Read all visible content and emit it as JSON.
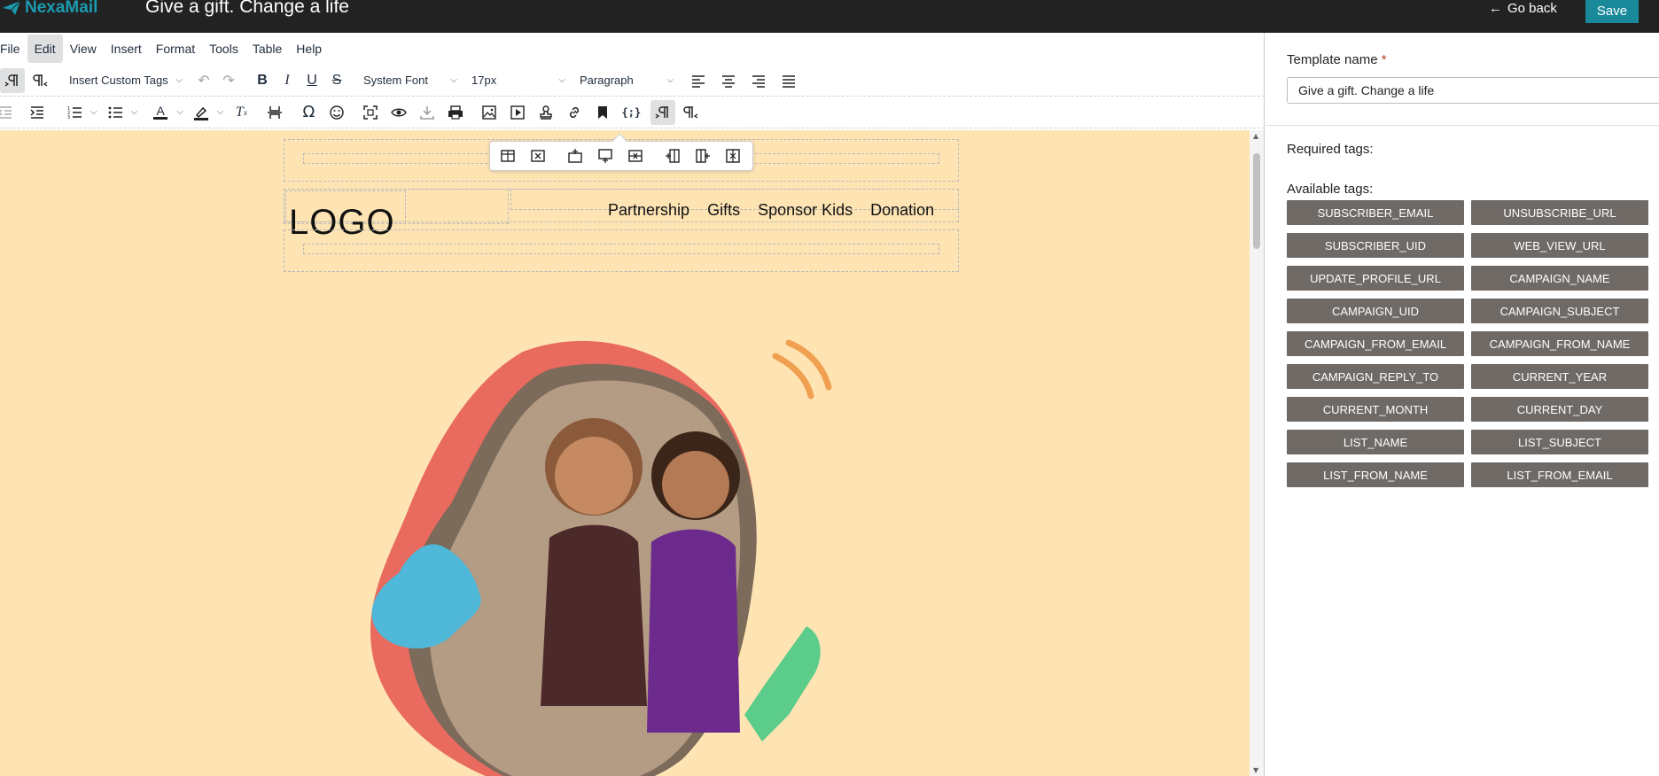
{
  "header": {
    "brand": "NexaMail",
    "title": "Give a gift. Change a life",
    "go_back": "Go back",
    "save": "Save"
  },
  "menubar": [
    "File",
    "Edit",
    "View",
    "Insert",
    "Format",
    "Tools",
    "Table",
    "Help"
  ],
  "toolbar": {
    "custom_tags": "Insert Custom Tags",
    "font_family": "System Font",
    "font_size": "17px",
    "block_format": "Paragraph",
    "bold": "B",
    "italic": "I",
    "underline": "U",
    "strike": "S",
    "omega": "Ω",
    "text_color_letter": "A"
  },
  "canvas": {
    "logo": "LOGO",
    "nav": [
      "Partnership",
      "Gifts",
      "Sponsor Kids",
      "Donation"
    ]
  },
  "panel": {
    "template_label": "Template name",
    "required_star": "*",
    "template_value": "Give a gift. Change a life",
    "required_tags_label": "Required tags:",
    "available_tags_label": "Available tags:",
    "tags": [
      "SUBSCRIBER_EMAIL",
      "UNSUBSCRIBE_URL",
      "SUBSCRIBER_UID",
      "WEB_VIEW_URL",
      "UPDATE_PROFILE_URL",
      "CAMPAIGN_NAME",
      "CAMPAIGN_UID",
      "CAMPAIGN_SUBJECT",
      "CAMPAIGN_FROM_EMAIL",
      "CAMPAIGN_FROM_NAME",
      "CAMPAIGN_REPLY_TO",
      "CURRENT_YEAR",
      "CURRENT_MONTH",
      "CURRENT_DAY",
      "LIST_NAME",
      "LIST_SUBJECT",
      "LIST_FROM_NAME",
      "LIST_FROM_EMAIL"
    ]
  },
  "colors": {
    "header_bg": "#222222",
    "brand": "#1a9bb0",
    "save_bg": "#1a8a9a",
    "canvas_bg": "#ffe4b3",
    "tag_bg": "#6f6a66"
  }
}
